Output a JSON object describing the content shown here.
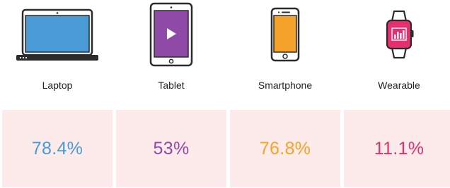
{
  "devices": [
    {
      "label": "Laptop",
      "value": "78.4%",
      "color": "#4a9ad6",
      "icon": "laptop-icon"
    },
    {
      "label": "Tablet",
      "value": "53%",
      "color": "#8e4aa6",
      "icon": "tablet-icon"
    },
    {
      "label": "Smartphone",
      "value": "76.8%",
      "color": "#f5a32a",
      "icon": "smartphone-icon"
    },
    {
      "label": "Wearable",
      "value": "11.1%",
      "color": "#e6306e",
      "icon": "smartwatch-icon"
    }
  ],
  "theme": {
    "tile_background": "#fdebec",
    "outline": "#2b2b2b"
  }
}
